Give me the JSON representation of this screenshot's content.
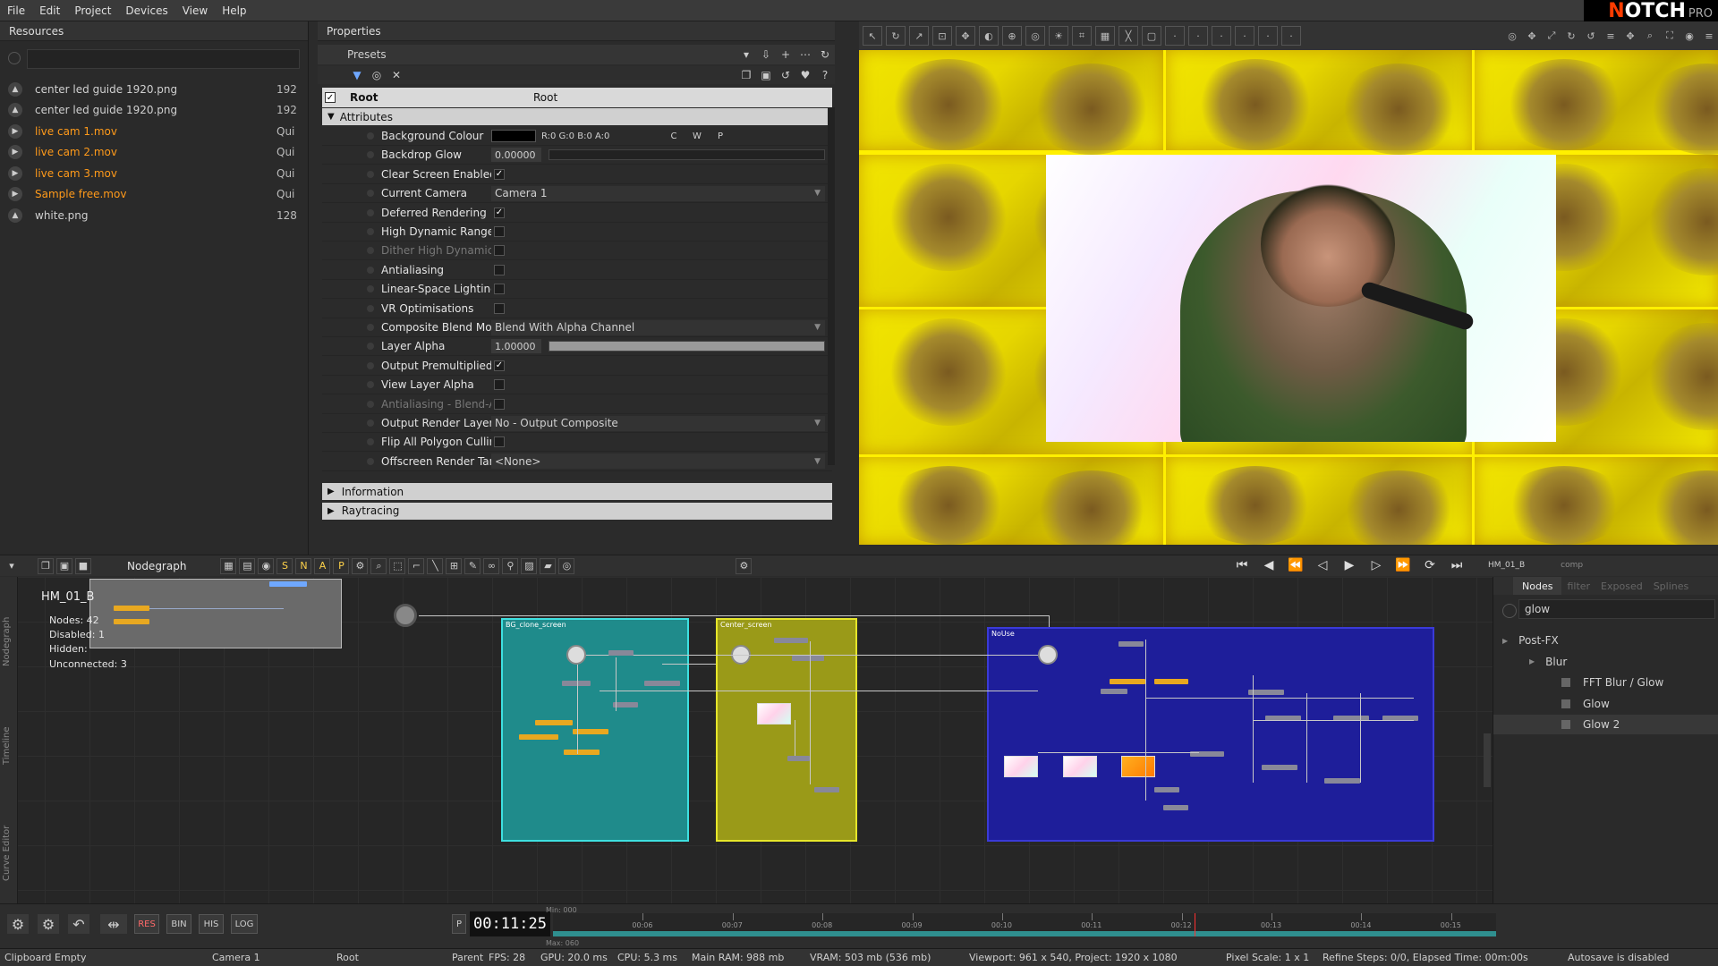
{
  "menu": [
    "File",
    "Edit",
    "Project",
    "Devices",
    "View",
    "Help"
  ],
  "logo": {
    "brand": "NOTCH",
    "edition": "PRO"
  },
  "resources": {
    "title": "Resources",
    "items": [
      {
        "name": "center led guide 1920.png",
        "size": "192",
        "live": false
      },
      {
        "name": "center led guide 1920.png",
        "size": "192",
        "live": false
      },
      {
        "name": "live cam 1.mov",
        "size": "Qui",
        "live": true
      },
      {
        "name": "live cam 2.mov",
        "size": "Qui",
        "live": true
      },
      {
        "name": "live cam 3.mov",
        "size": "Qui",
        "live": true
      },
      {
        "name": "Sample free.mov",
        "size": "Qui",
        "live": true
      },
      {
        "name": "white.png",
        "size": "128",
        "live": false
      }
    ]
  },
  "properties": {
    "title": "Properties",
    "presets_label": "Presets",
    "root_label": "Root",
    "root_value": "Root",
    "attributes_label": "Attributes",
    "attrs": [
      {
        "label": "Background Colour",
        "kind": "colour",
        "value": "R:0 G:0 B:0 A:0",
        "extra": [
          "C",
          "W",
          "P"
        ],
        "dim": false
      },
      {
        "label": "Backdrop Glow",
        "kind": "slider",
        "value": "0.00000",
        "fill": 0,
        "dim": false
      },
      {
        "label": "Clear Screen Enabled",
        "kind": "check",
        "checked": true,
        "dim": false
      },
      {
        "label": "Current Camera",
        "kind": "drop",
        "value": "Camera 1",
        "dim": false
      },
      {
        "label": "Deferred Rendering",
        "kind": "check",
        "checked": true,
        "dim": false
      },
      {
        "label": "High Dynamic Range",
        "kind": "check",
        "checked": false,
        "dim": false
      },
      {
        "label": "Dither High Dynamic",
        "kind": "check",
        "checked": false,
        "dim": true
      },
      {
        "label": "Antialiasing",
        "kind": "check",
        "checked": false,
        "dim": false
      },
      {
        "label": "Linear-Space Lighting",
        "kind": "check",
        "checked": false,
        "dim": false
      },
      {
        "label": "VR Optimisations",
        "kind": "check",
        "checked": false,
        "dim": false
      },
      {
        "label": "Composite Blend Moc",
        "kind": "drop",
        "value": "Blend With Alpha Channel",
        "dim": false
      },
      {
        "label": "Layer Alpha",
        "kind": "slider",
        "value": "1.00000",
        "fill": 1,
        "dim": false
      },
      {
        "label": "Output Premultiplied",
        "kind": "check",
        "checked": true,
        "dim": false
      },
      {
        "label": "View Layer Alpha",
        "kind": "check",
        "checked": false,
        "dim": false
      },
      {
        "label": "Antialiasing - Blend-A",
        "kind": "check",
        "checked": false,
        "dim": true
      },
      {
        "label": "Output Render Layers",
        "kind": "drop",
        "value": "No - Output Composite",
        "dim": false
      },
      {
        "label": "Flip All Polygon Cullir",
        "kind": "check",
        "checked": false,
        "dim": false
      },
      {
        "label": "Offscreen Render Tarc",
        "kind": "drop",
        "value": "<None>",
        "dim": false
      }
    ],
    "sections": [
      "Information",
      "Raytracing"
    ]
  },
  "nodegraph": {
    "title": "Nodegraph",
    "toolbar_letters": [
      "S",
      "N",
      "A",
      "P"
    ],
    "stats": {
      "name": "HM_01_B",
      "nodes": "Nodes: 42",
      "disabled": "Disabled: 1",
      "hidden": "Hidden:",
      "unconnected": "Unconnected: 3"
    },
    "groups": [
      {
        "label": "BG_clone_screen",
        "color": "#1f8b8b",
        "border": "#3ee0e0"
      },
      {
        "label": "Center_screen",
        "color": "#9a9a18",
        "border": "#e6e62a"
      },
      {
        "label": "NoUse",
        "color": "#1e1e9a",
        "border": "#3a3ad8"
      }
    ],
    "side_tabs": [
      "Nodegraph",
      "Timeline",
      "Curve Editor"
    ]
  },
  "nodes_panel": {
    "tabs": [
      "Nodes",
      "filter",
      "Exposed",
      "Splines"
    ],
    "search_value": "glow",
    "tree": [
      {
        "label": "Post-FX",
        "level": 0
      },
      {
        "label": "Blur",
        "level": 1
      },
      {
        "label": "FFT Blur / Glow",
        "level": 2
      },
      {
        "label": "Glow",
        "level": 2
      },
      {
        "label": "Glow 2",
        "level": 2
      }
    ],
    "layer_name": "HM_01_B",
    "layer_tag": "comp"
  },
  "timeline": {
    "time": "00:11:25",
    "min": "Min: 000",
    "max": "Max: 060",
    "ticks": [
      "00:06",
      "00:07",
      "00:08",
      "00:09",
      "00:10",
      "00:11",
      "00:12",
      "00:13",
      "00:14",
      "00:15"
    ],
    "buttons": [
      "RES",
      "BIN",
      "HIS",
      "LOG"
    ],
    "progress": 0.68
  },
  "status": {
    "clipboard": "Clipboard Empty",
    "camera": "Camera 1",
    "root": "Root",
    "parent": "Parent",
    "fps": "FPS: 28",
    "gpu": "GPU: 20.0 ms",
    "cpu": "CPU: 5.3 ms",
    "ram": "Main RAM: 988 mb",
    "vram": "VRAM: 503 mb (536 mb)",
    "viewport": "Viewport: 961 x 540, Project: 1920 x 1080",
    "pixel": "Pixel Scale: 1 x 1",
    "refine": "Refine Steps: 0/0, Elapsed Time: 00m:00s",
    "autosave": "Autosave is disabled"
  },
  "colors": {
    "accent_orange": "#ff9a1a",
    "viewport_bg": "#fff000",
    "timeline_accent": "#3aa0a0"
  }
}
